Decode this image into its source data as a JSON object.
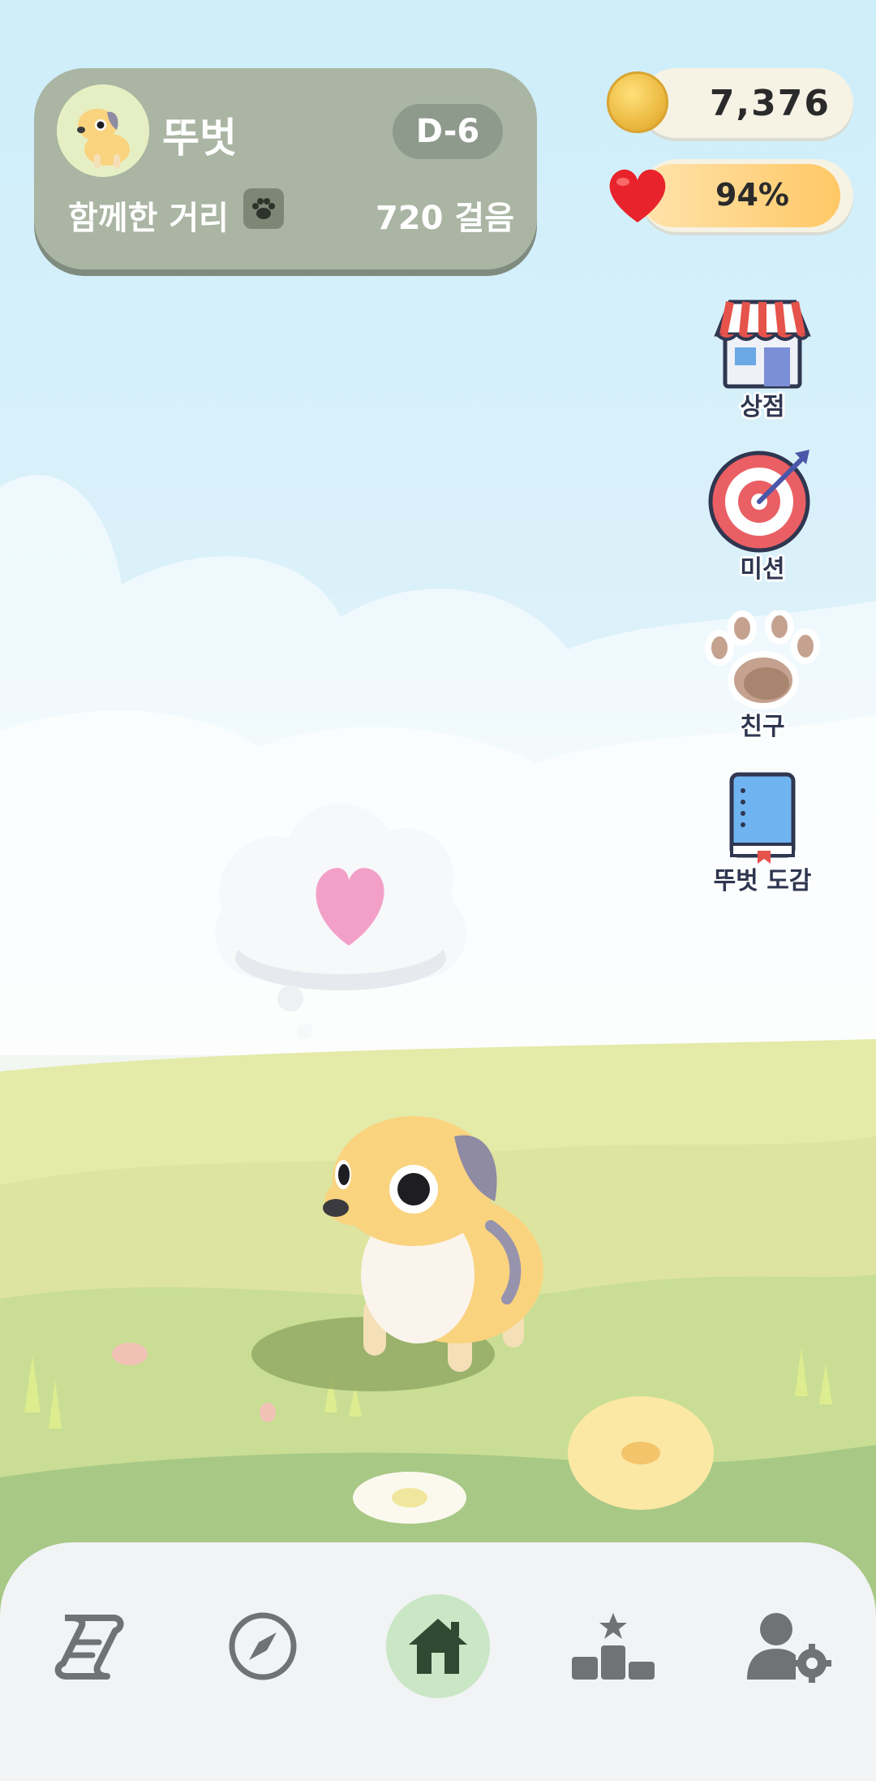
{
  "profile": {
    "pet_name": "뚜벗",
    "dday": "D-6",
    "distance_label": "함께한 거리",
    "steps": "720 걸음"
  },
  "currency": {
    "coins": "7,376",
    "affection": "94%",
    "affection_level": 0.94
  },
  "side_menu": [
    {
      "label": "상점",
      "icon": "shop-icon"
    },
    {
      "label": "미션",
      "icon": "target-icon"
    },
    {
      "label": "친구",
      "icon": "paw-icon"
    },
    {
      "label": "뚜벗 도감",
      "icon": "book-icon"
    }
  ],
  "thought_bubble": {
    "icon": "heart-icon"
  },
  "bottom_nav": [
    {
      "name": "quest-scroll",
      "icon": "scroll-icon",
      "active": false
    },
    {
      "name": "explore",
      "icon": "compass-icon",
      "active": false
    },
    {
      "name": "home",
      "icon": "home-icon",
      "active": true
    },
    {
      "name": "ranking",
      "icon": "podium-icon",
      "active": false
    },
    {
      "name": "account-settings",
      "icon": "user-settings-icon",
      "active": false
    }
  ],
  "colors": {
    "card": "#aab5a3",
    "nav_active": "#c9e6c5",
    "affection_fill": "#ffc865"
  }
}
